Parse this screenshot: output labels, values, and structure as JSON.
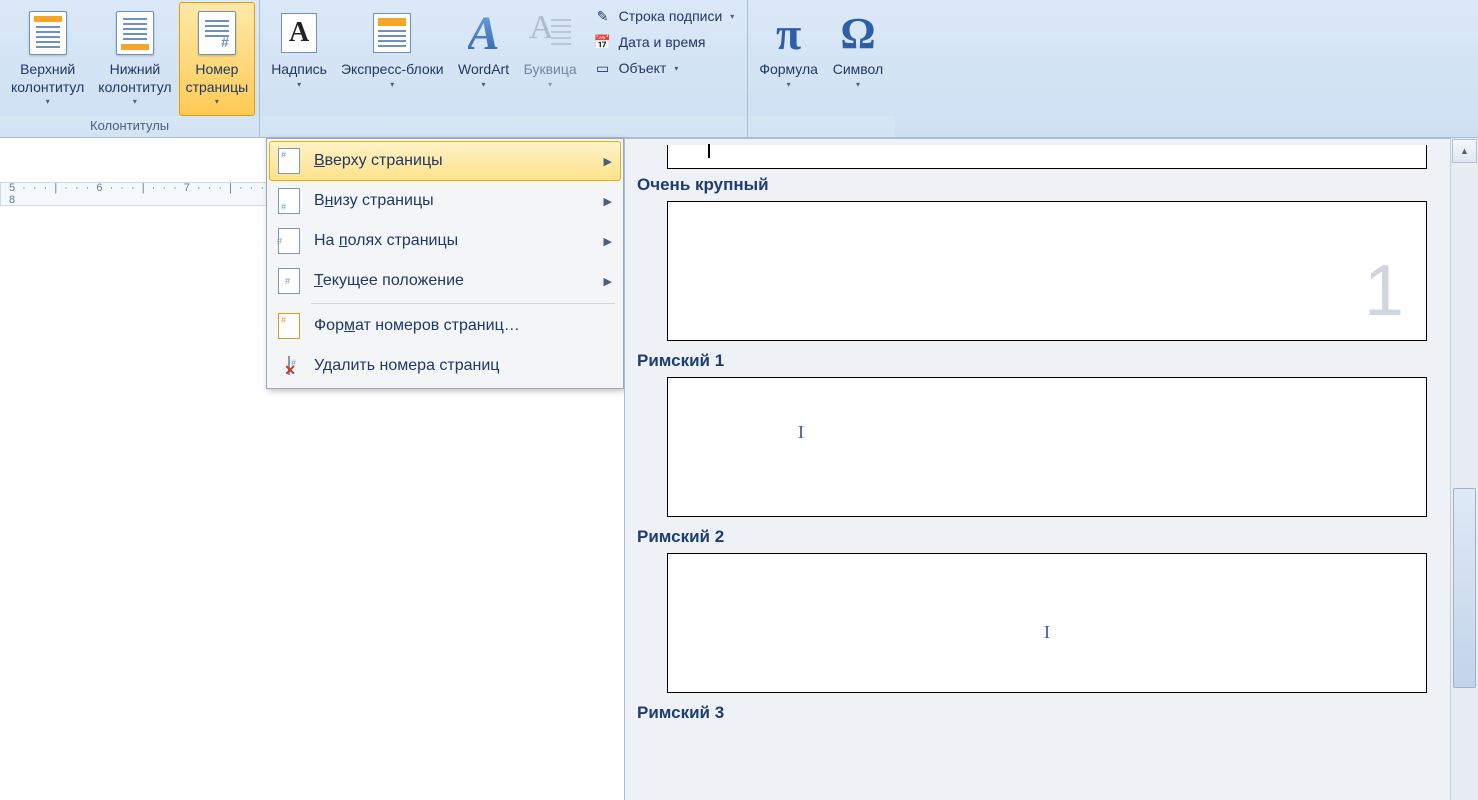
{
  "ribbon": {
    "group_headers": "Колонтитулы",
    "header_top": "Верхний\nколонтитул",
    "header_bottom": "Нижний\nколонтитул",
    "page_number": "Номер\nстраницы",
    "text_box": "Надпись",
    "quick_parts": "Экспресс-блоки",
    "wordart": "WordArt",
    "drop_cap": "Буквица",
    "signature_line": "Строка подписи",
    "date_time": "Дата и время",
    "object": "Объект",
    "formula": "Формула",
    "symbol": "Символ"
  },
  "ruler_text": "5 · · · | · · · 6 · · · | · · · 7 · · · | · · · 8",
  "menu": {
    "top_of_page": "Вверху страницы",
    "bottom_of_page": "Внизу страницы",
    "page_margins": "На полях страницы",
    "current_position": "Текущее положение",
    "format_numbers": "Формат номеров страниц…",
    "remove_numbers": "Удалить номера страниц"
  },
  "gallery": {
    "section1": "Очень крупный",
    "big_number": "1",
    "section2": "Римский 1",
    "roman1": "I",
    "section3": "Римский 2",
    "roman2": "I",
    "section4": "Римский 3"
  }
}
